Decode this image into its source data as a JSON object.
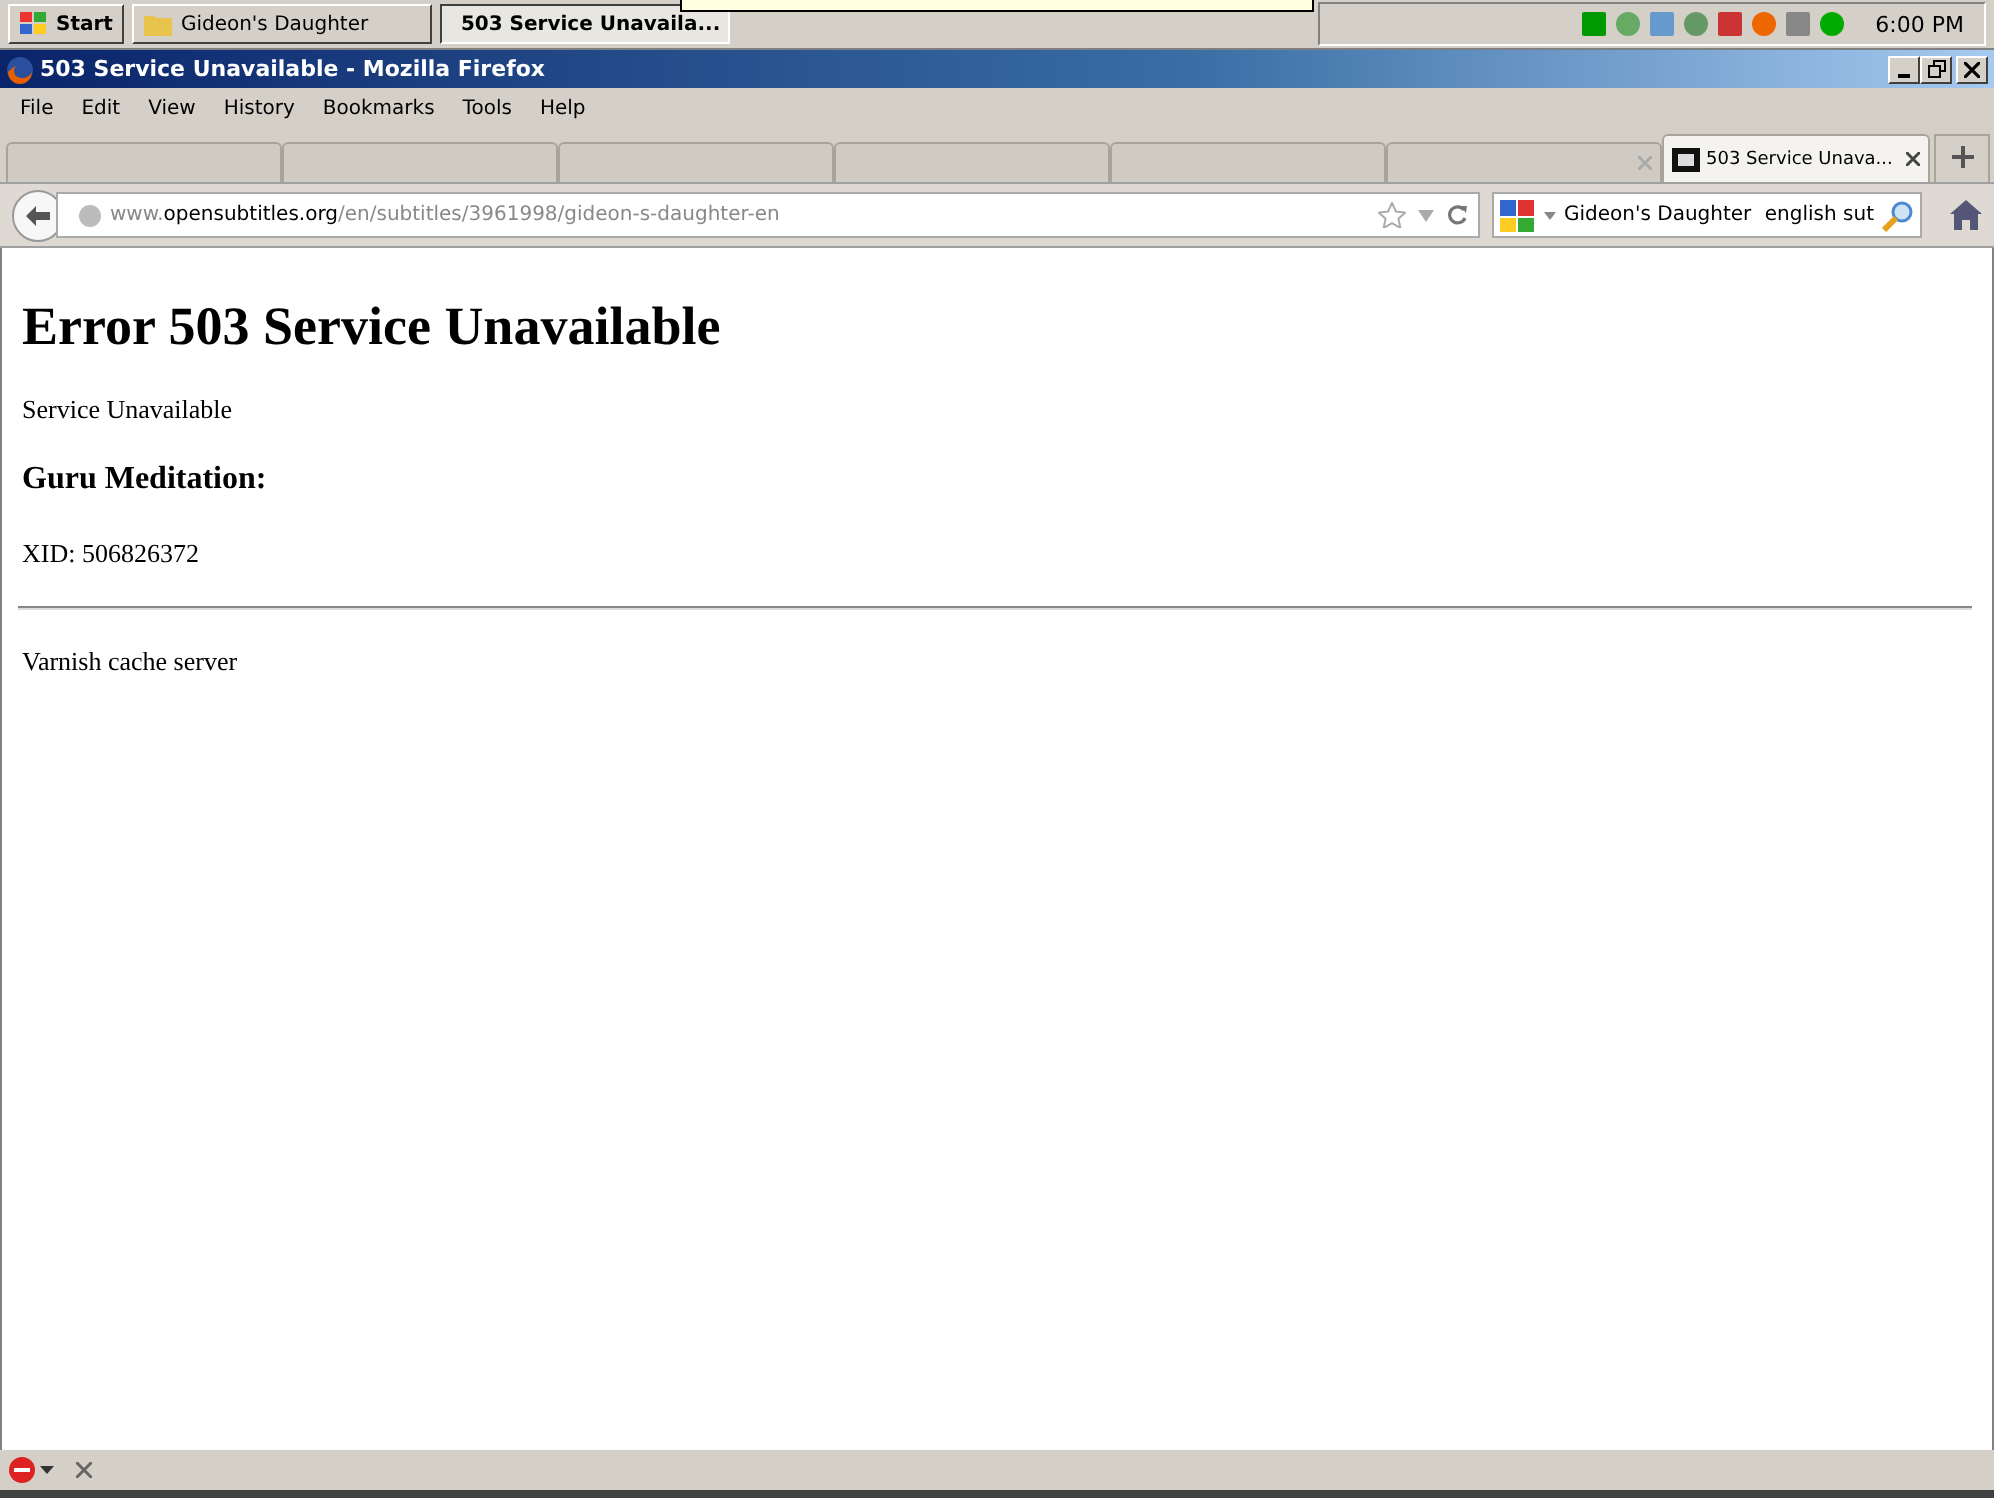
{
  "taskbar": {
    "start": "Start",
    "buttons": [
      {
        "label": "Gideon's Daughter",
        "kind": "folder",
        "selected": false
      },
      {
        "label": "503 Service Unavaila...",
        "kind": "browser",
        "selected": true
      }
    ],
    "clock": "6:00 PM"
  },
  "window": {
    "title": "503 Service Unavailable - Mozilla Firefox"
  },
  "menu": [
    "File",
    "Edit",
    "View",
    "History",
    "Bookmarks",
    "Tools",
    "Help"
  ],
  "tabs": [
    {
      "selected": false
    },
    {
      "selected": false
    },
    {
      "selected": false
    },
    {
      "selected": false
    },
    {
      "selected": false
    },
    {
      "selected": false,
      "closable": true
    },
    {
      "label": "503 Service Unava...",
      "selected": true,
      "closable": true
    }
  ],
  "address": {
    "prefix": "www.",
    "domain": "opensubtitles.org",
    "path": "/en/subtitles/3961998/gideon-s-daughter-en"
  },
  "search": {
    "engine_text": "Gideon's Daughter",
    "value": "english sut"
  },
  "page": {
    "heading": "Error 503 Service Unavailable",
    "message": "Service Unavailable",
    "subheading": "Guru Meditation:",
    "xid": "XID: 506826372",
    "footer": "Varnish cache server"
  }
}
